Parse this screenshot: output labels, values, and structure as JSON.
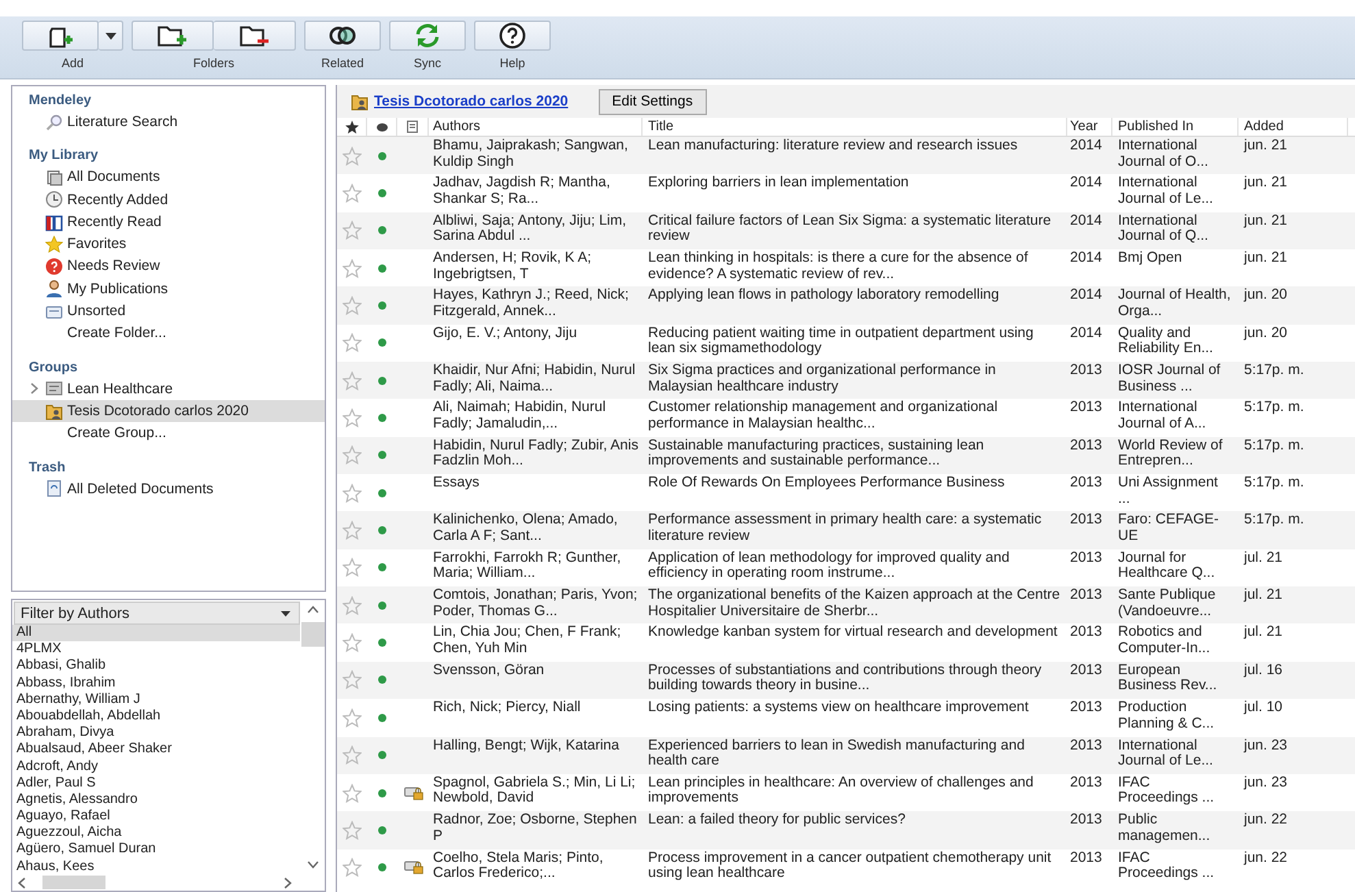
{
  "toolbar": {
    "groups": [
      {
        "label": "Add",
        "buttons": [
          {
            "kind": "add"
          },
          {
            "kind": "dropdown"
          }
        ]
      },
      {
        "label": "Folders",
        "buttons": [
          {
            "kind": "folder-add"
          },
          {
            "kind": "folder-remove"
          }
        ]
      },
      {
        "label": "Related",
        "buttons": [
          {
            "kind": "related"
          }
        ]
      },
      {
        "label": "Sync",
        "buttons": [
          {
            "kind": "sync"
          }
        ]
      },
      {
        "label": "Help",
        "buttons": [
          {
            "kind": "help"
          }
        ]
      }
    ]
  },
  "sidebar": {
    "sections": [
      {
        "title": "Mendeley",
        "items": [
          {
            "label": "Literature Search",
            "kind": "search",
            "selected": false
          }
        ]
      },
      {
        "title": "My Library",
        "items": [
          {
            "label": "All Documents",
            "kind": "documents",
            "selected": false
          },
          {
            "label": "Recently Added",
            "kind": "recent",
            "selected": false
          },
          {
            "label": "Recently Read",
            "kind": "read",
            "selected": false
          },
          {
            "label": "Favorites",
            "kind": "favorites",
            "selected": false
          },
          {
            "label": "Needs Review",
            "kind": "review",
            "selected": false
          },
          {
            "label": "My Publications",
            "kind": "publications",
            "selected": false
          },
          {
            "label": "Unsorted",
            "kind": "unsorted",
            "selected": false
          },
          {
            "label": "Create Folder...",
            "kind": "action",
            "selected": false
          }
        ]
      },
      {
        "title": "Groups",
        "items": [
          {
            "label": "Lean Healthcare",
            "kind": "group",
            "expanded": false,
            "selected": false
          },
          {
            "label": "Tesis Dcotorado carlos 2020",
            "kind": "collection",
            "selected": true
          },
          {
            "label": "Create Group...",
            "kind": "action",
            "selected": false
          }
        ]
      },
      {
        "title": "Trash",
        "items": [
          {
            "label": "All Deleted Documents",
            "kind": "trash",
            "selected": false
          }
        ]
      }
    ]
  },
  "filter": {
    "title": "Filter by Authors",
    "items": [
      {
        "label": "All",
        "selected": true
      },
      {
        "label": "4PLMX",
        "selected": false
      },
      {
        "label": "Abbasi, Ghalib",
        "selected": false
      },
      {
        "label": "Abbass, Ibrahim",
        "selected": false
      },
      {
        "label": "Abernathy, William J",
        "selected": false
      },
      {
        "label": "Abouabdellah, Abdellah",
        "selected": false
      },
      {
        "label": "Abraham, Divya",
        "selected": false
      },
      {
        "label": "Abualsaud, Abeer Shaker",
        "selected": false
      },
      {
        "label": "Adcroft, Andy",
        "selected": false
      },
      {
        "label": "Adler, Paul S",
        "selected": false
      },
      {
        "label": "Agnetis, Alessandro",
        "selected": false
      },
      {
        "label": "Aguayo, Rafael",
        "selected": false
      },
      {
        "label": "Aguezzoul, Aicha",
        "selected": false
      },
      {
        "label": "Agüero, Samuel Duran",
        "selected": false
      },
      {
        "label": "Ahaus, Kees",
        "selected": false
      }
    ]
  },
  "collection": {
    "title": "Tesis Dcotorado carlos 2020",
    "button": "Edit Settings"
  },
  "table": {
    "columns": [
      "Authors",
      "Title",
      "Year",
      "Published In",
      "Added"
    ],
    "rows": [
      {
        "starred": false,
        "unread": true,
        "attachment": false,
        "authors": "Bhamu, Jaiprakash; Sangwan, Kuldip Singh",
        "title": "Lean manufacturing: literature review and research issues",
        "year": "2014",
        "published": "International Journal of O...",
        "added": "jun. 21"
      },
      {
        "starred": false,
        "unread": true,
        "attachment": false,
        "authors": "Jadhav, Jagdish R; Mantha, Shankar S; Ra...",
        "title": "Exploring barriers in lean implementation",
        "year": "2014",
        "published": "International Journal of Le...",
        "added": "jun. 21"
      },
      {
        "starred": false,
        "unread": true,
        "attachment": false,
        "authors": "Albliwi, Saja; Antony, Jiju; Lim, Sarina Abdul ...",
        "title": "Critical failure factors of Lean Six Sigma: a systematic literature review",
        "year": "2014",
        "published": "International Journal of Q...",
        "added": "jun. 21"
      },
      {
        "starred": false,
        "unread": true,
        "attachment": false,
        "authors": "Andersen, H; Rovik, K A; Ingebrigtsen, T",
        "title": "Lean thinking in hospitals: is there a cure for the absence of evidence? A systematic review of rev...",
        "year": "2014",
        "published": "Bmj Open",
        "added": "jun. 21"
      },
      {
        "starred": false,
        "unread": true,
        "attachment": false,
        "authors": "Hayes, Kathryn J.; Reed, Nick; Fitzgerald, Annek...",
        "title": "Applying lean flows in pathology laboratory remodelling",
        "year": "2014",
        "published": "Journal of Health, Orga...",
        "added": "jun. 20"
      },
      {
        "starred": false,
        "unread": true,
        "attachment": false,
        "authors": "Gijo, E. V.; Antony, Jiju",
        "title": "Reducing patient waiting time in outpatient department using lean six sigmamethodology",
        "year": "2014",
        "published": "Quality and Reliability En...",
        "added": "jun. 20"
      },
      {
        "starred": false,
        "unread": true,
        "attachment": false,
        "authors": "Khaidir, Nur Afni; Habidin, Nurul Fadly; Ali, Naima...",
        "title": "Six Sigma practices and organizational performance in Malaysian healthcare industry",
        "year": "2013",
        "published": "IOSR Journal of Business ...",
        "added": "5:17p. m."
      },
      {
        "starred": false,
        "unread": true,
        "attachment": false,
        "authors": "Ali, Naimah; Habidin, Nurul Fadly; Jamaludin,...",
        "title": "Customer relationship management and organizational performance in Malaysian healthc...",
        "year": "2013",
        "published": "International Journal of A...",
        "added": "5:17p. m."
      },
      {
        "starred": false,
        "unread": true,
        "attachment": false,
        "authors": "Habidin, Nurul Fadly; Zubir, Anis Fadzlin Moh...",
        "title": "Sustainable manufacturing practices, sustaining lean improvements and sustainable performance...",
        "year": "2013",
        "published": "World Review of Entrepren...",
        "added": "5:17p. m."
      },
      {
        "starred": false,
        "unread": true,
        "attachment": false,
        "authors": "Essays",
        "title": "Role Of Rewards On Employees Performance Business",
        "year": "2013",
        "published": "Uni Assignment ...",
        "added": "5:17p. m."
      },
      {
        "starred": false,
        "unread": true,
        "attachment": false,
        "authors": "Kalinichenko, Olena; Amado, Carla A F; Sant...",
        "title": "Performance assessment in primary health care: a systematic literature review",
        "year": "2013",
        "published": "Faro: CEFAGE-UE",
        "added": "5:17p. m."
      },
      {
        "starred": false,
        "unread": true,
        "attachment": false,
        "authors": "Farrokhi, Farrokh R; Gunther, Maria; William...",
        "title": "Application of lean methodology for improved quality and efficiency in operating room instrume...",
        "year": "2013",
        "published": "Journal for Healthcare Q...",
        "added": "jul. 21"
      },
      {
        "starred": false,
        "unread": true,
        "attachment": false,
        "authors": "Comtois, Jonathan; Paris, Yvon; Poder, Thomas G...",
        "title": "The organizational benefits of the Kaizen approach at the Centre Hospitalier Universitaire de Sherbr...",
        "year": "2013",
        "published": "Sante Publique (Vandoeuvre...",
        "added": "jul. 21"
      },
      {
        "starred": false,
        "unread": true,
        "attachment": false,
        "authors": "Lin, Chia Jou; Chen, F Frank; Chen, Yuh Min",
        "title": "Knowledge kanban system for virtual research and development",
        "year": "2013",
        "published": "Robotics and Computer-In...",
        "added": "jul. 21"
      },
      {
        "starred": false,
        "unread": true,
        "attachment": false,
        "authors": "Svensson, Göran",
        "title": "Processes of substantiations and contributions through theory building towards theory in busine...",
        "year": "2013",
        "published": "European Business Rev...",
        "added": "jul. 16"
      },
      {
        "starred": false,
        "unread": true,
        "attachment": false,
        "authors": "Rich, Nick; Piercy, Niall",
        "title": "Losing patients: a systems view on healthcare improvement",
        "year": "2013",
        "published": "Production Planning & C...",
        "added": "jul. 10"
      },
      {
        "starred": false,
        "unread": true,
        "attachment": false,
        "authors": "Halling, Bengt; Wijk, Katarina",
        "title": "Experienced barriers to lean in Swedish manufacturing and health care",
        "year": "2013",
        "published": "International Journal of Le...",
        "added": "jun. 23"
      },
      {
        "starred": false,
        "unread": true,
        "attachment": true,
        "authors": "Spagnol, Gabriela S.; Min, Li Li; Newbold, David",
        "title": "Lean principles in healthcare: An overview of challenges and improvements",
        "year": "2013",
        "published": "IFAC Proceedings ...",
        "added": "jun. 23"
      },
      {
        "starred": false,
        "unread": true,
        "attachment": false,
        "authors": "Radnor, Zoe; Osborne, Stephen P",
        "title": "Lean: a failed theory for public services?",
        "year": "2013",
        "published": "Public managemen...",
        "added": "jun. 22"
      },
      {
        "starred": false,
        "unread": true,
        "attachment": true,
        "authors": "Coelho, Stela Maris; Pinto, Carlos Frederico;...",
        "title": "Process improvement in a cancer outpatient chemotherapy unit using lean healthcare",
        "year": "2013",
        "published": "IFAC Proceedings ...",
        "added": "jun. 22"
      }
    ]
  }
}
